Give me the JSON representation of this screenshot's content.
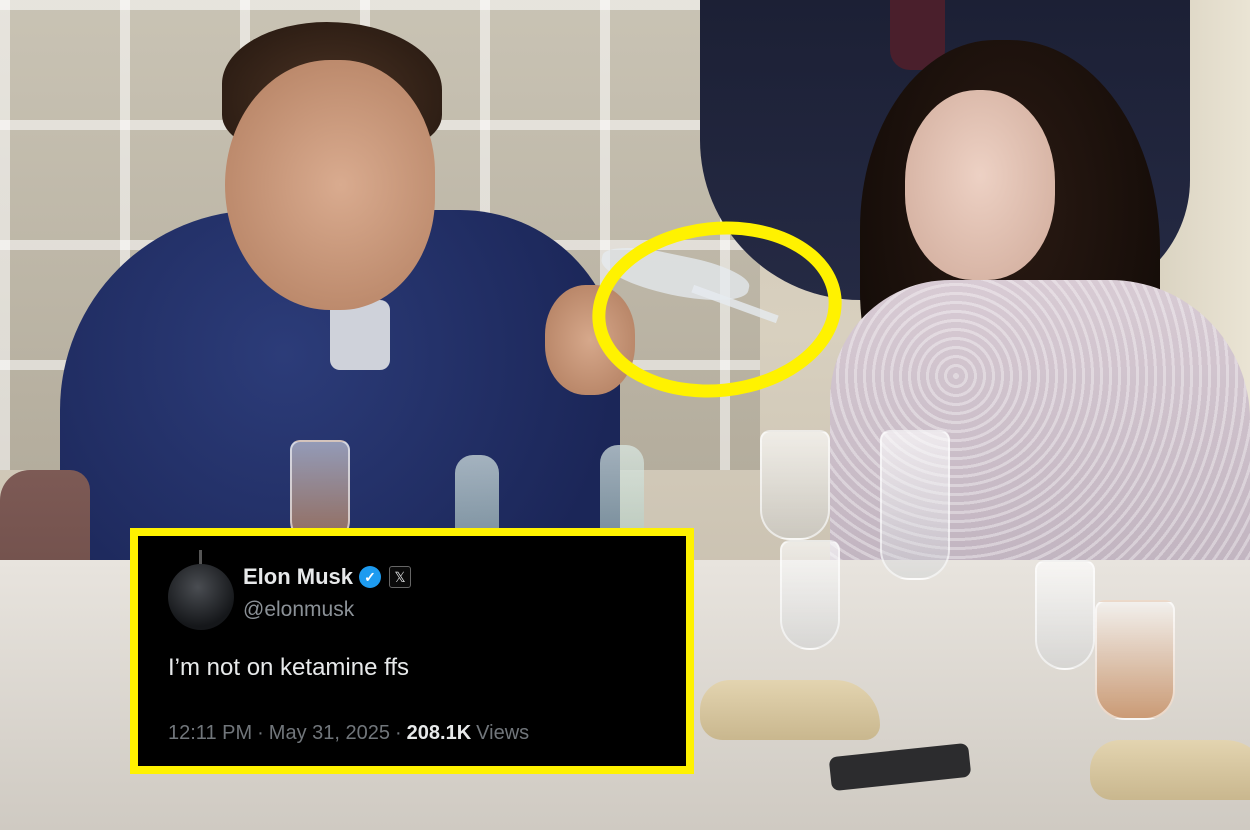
{
  "tweet": {
    "display_name": "Elon Musk",
    "handle": "@elonmusk",
    "verified_glyph": "✓",
    "x_badge_glyph": "𝕏",
    "text": "I’m not on ketamine ffs",
    "time": "12:11 PM",
    "date": "May 31, 2025",
    "views_count": "208.1K",
    "views_label": "Views",
    "separator": "·"
  },
  "colors": {
    "highlight": "#fff200",
    "card_background": "#000000",
    "verified": "#1d9bf0"
  },
  "icons": [
    "verified-badge-icon",
    "x-logo-icon"
  ]
}
